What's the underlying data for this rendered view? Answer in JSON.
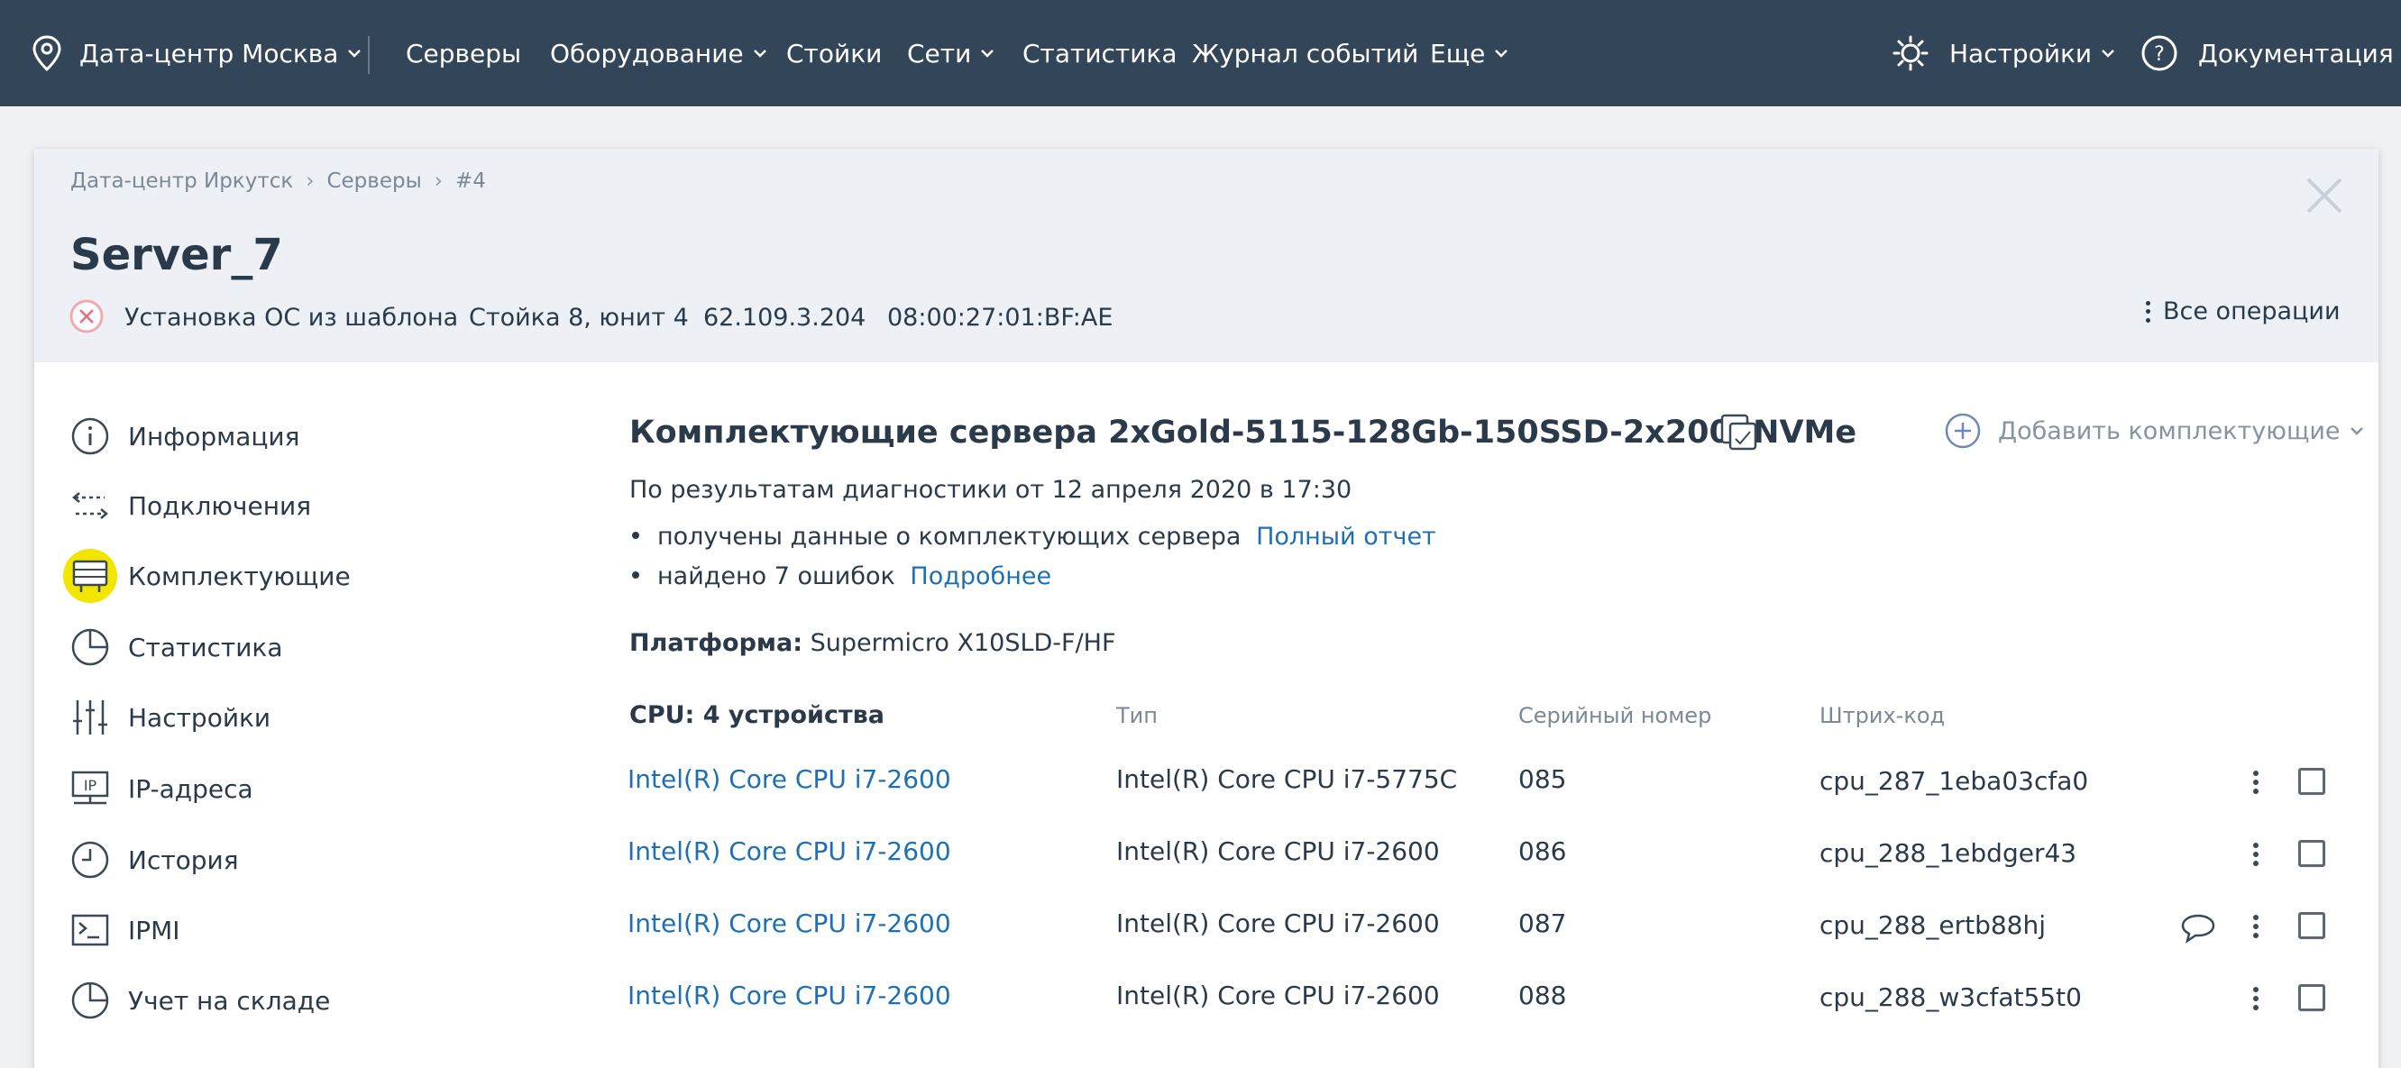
{
  "topbar": {
    "datacenter": "Дата-центр Москва",
    "nav": [
      {
        "label": "Серверы",
        "dropdown": false
      },
      {
        "label": "Оборудование",
        "dropdown": true
      },
      {
        "label": "Стойки",
        "dropdown": false
      },
      {
        "label": "Сети",
        "dropdown": true
      },
      {
        "label": "Статистика",
        "dropdown": false
      },
      {
        "label": "Журнал событий",
        "dropdown": false
      },
      {
        "label": "Еще",
        "dropdown": true
      }
    ],
    "settings": "Настройки",
    "docs": "Документация"
  },
  "breadcrumb": [
    "Дата-центр Иркутск",
    "Серверы",
    "#4"
  ],
  "server": {
    "name": "Server_7",
    "status": "Установка ОС из шаблона",
    "rack": "Стойка 8, юнит 4",
    "ip": "62.109.3.204",
    "mac": "08:00:27:01:BF:AE",
    "all_operations": "Все операции"
  },
  "sidebar": {
    "items": [
      {
        "label": "Информация",
        "icon": "info-icon",
        "active": false
      },
      {
        "label": "Подключения",
        "icon": "connections-icon",
        "active": false
      },
      {
        "label": "Комплектующие",
        "icon": "components-icon",
        "active": true
      },
      {
        "label": "Статистика",
        "icon": "pie-chart-icon",
        "active": false
      },
      {
        "label": "Настройки",
        "icon": "sliders-icon",
        "active": false
      },
      {
        "label": "IP-адреса",
        "icon": "ip-icon",
        "active": false
      },
      {
        "label": "История",
        "icon": "clock-icon",
        "active": false
      },
      {
        "label": "IPMI",
        "icon": "terminal-icon",
        "active": false
      },
      {
        "label": "Учет на складе",
        "icon": "pie-chart-icon",
        "active": false
      }
    ]
  },
  "content": {
    "title": "Комплектующие сервера 2xGold-5115-128Gb-150SSD-2x2000NVMe",
    "add_component": "Добавить комплектующие",
    "diagnostics": "По результатам диагностики от 12 апреля 2020 в 17:30",
    "bullet1_text": "получены данные о комплектующих сервера",
    "bullet1_link": "Полный отчет",
    "bullet2_text": "найдено 7 ошибок",
    "bullet2_link": "Подробнее",
    "platform_label": "Платформа:",
    "platform_value": "Supermicro X10SLD-F/HF",
    "cpu_header": "CPU: 4 устройства",
    "columns": {
      "type": "Тип",
      "serial": "Серийный номер",
      "barcode": "Штрих-код"
    },
    "rows": [
      {
        "name": "Intel(R) Core CPU i7-2600",
        "type": "Intel(R) Core CPU i7-5775C",
        "serial": "085",
        "barcode": "cpu_287_1eba03cfa0",
        "comment": false
      },
      {
        "name": "Intel(R) Core CPU i7-2600",
        "type": "Intel(R) Core CPU i7-2600",
        "serial": "086",
        "barcode": "cpu_288_1ebdger43",
        "comment": false
      },
      {
        "name": "Intel(R) Core CPU i7-2600",
        "type": "Intel(R) Core CPU i7-2600",
        "serial": "087",
        "barcode": "cpu_288_ertb88hj",
        "comment": true
      },
      {
        "name": "Intel(R) Core CPU i7-2600",
        "type": "Intel(R) Core CPU i7-2600",
        "serial": "088",
        "barcode": "cpu_288_w3cfat55t0",
        "comment": false
      }
    ]
  },
  "colors": {
    "topbar": "#334559",
    "link": "#1f6fb5",
    "highlight": "#f2e600",
    "header_bg": "#edf1f6"
  }
}
